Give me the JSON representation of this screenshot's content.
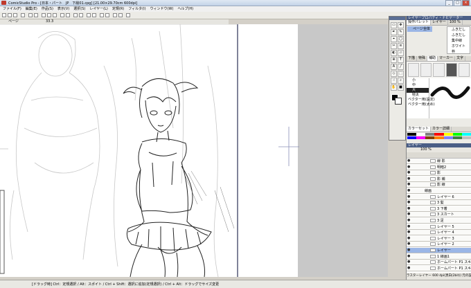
{
  "window": {
    "title": "ComicStudio Pro - [日本・パート　JP　下絵01.cpg] [21.00×29.70cm 600dpi]",
    "minimize": "_",
    "maximize": "□",
    "close": "×"
  },
  "menu": [
    "ファイル(F)",
    "編集(E)",
    "作品(S)",
    "表示(V)",
    "選択(S)",
    "レイヤー(L)",
    "定規(R)",
    "フィルタ(I)",
    "ウィンドウ(W)",
    "ヘルプ(H)"
  ],
  "docbar": {
    "page_label": "ページ",
    "zoom": "33.3"
  },
  "tool_palette": {
    "tools": [
      "▭",
      "✥",
      "✒",
      "✎",
      "⌖",
      "◯",
      "✂",
      "≋",
      "◐",
      "▱",
      "⊕",
      "T",
      "A",
      "╱",
      "◇",
      "⬚",
      "☝",
      "⌕",
      "✋",
      "■"
    ]
  },
  "pages_panel": {
    "title": "レイヤープロパティ・ナビゲーター",
    "tabs": [
      "操作パレット",
      "レイヤー",
      "100 %"
    ],
    "page_name": "ページ全体",
    "items": [
      "ふきだし",
      "ふきだし",
      "集中線",
      "ホワイト",
      "枠"
    ]
  },
  "tool_options": {
    "tabs": [
      "下描",
      "特殊",
      "補助",
      "マーカー",
      "文字"
    ],
    "brush_labels": [
      "小",
      "中",
      "大",
      "極太"
    ],
    "presets": [
      "ベクター用(設定)",
      "ベクター用(太め)"
    ]
  },
  "color_palette": {
    "tabs": [
      "カラーセット",
      "カラー詳細"
    ],
    "swatches": [
      "#000000",
      "#ffffff",
      "#7f7f7f",
      "#ff0000",
      "#ffff00",
      "#00ff00",
      "#00ffff",
      "#0000ff",
      "#ff00ff",
      "#804000",
      "#ff8000",
      "#8080ff",
      "#408040",
      "#c0c0c0"
    ]
  },
  "layer_panel": {
    "title": "レイヤー",
    "opacity": "100 %",
    "layers": [
      {
        "name": "線 影",
        "selected": false,
        "folder": false
      },
      {
        "name": "明暗2",
        "selected": false,
        "folder": false
      },
      {
        "name": "影",
        "selected": false,
        "folder": false
      },
      {
        "name": "影 補",
        "selected": false,
        "folder": false
      },
      {
        "name": "影 線",
        "selected": false,
        "folder": false
      },
      {
        "name": "線画",
        "selected": false,
        "folder": true
      },
      {
        "name": "レイヤー 6",
        "selected": false,
        "folder": false
      },
      {
        "name": "3 髪",
        "selected": false,
        "folder": false
      },
      {
        "name": "3 下着",
        "selected": false,
        "folder": false
      },
      {
        "name": "3 スカート",
        "selected": false,
        "folder": false
      },
      {
        "name": "3 足",
        "selected": false,
        "folder": false
      },
      {
        "name": "レイヤー 5",
        "selected": false,
        "folder": false
      },
      {
        "name": "レイヤー 4",
        "selected": false,
        "folder": false
      },
      {
        "name": "レイヤー 3",
        "selected": false,
        "folder": false
      },
      {
        "name": "レイヤー 2",
        "selected": false,
        "folder": false
      },
      {
        "name": "レイヤー",
        "selected": true,
        "folder": false
      },
      {
        "name": "1 線画1",
        "selected": false,
        "folder": false
      },
      {
        "name": "ホームパート P1 スキャンの日",
        "selected": false,
        "folder": false
      },
      {
        "name": "ホームパート P1 スキャン",
        "selected": false,
        "folder": false
      }
    ],
    "footer": "ラスターレイヤー 600 dpi(黒白(2bit)) 元の設定"
  },
  "status": {
    "message": "[ドラッグ時] Ctrl：定規選択 / Alt：スポイト / Ctrl + Shift：選択に追加(定規選択) / Ctrl + Alt：ドラッグでサイズ変更"
  },
  "colors": {
    "accent": "#4a5e86",
    "selected": "#9bb6e6",
    "canvas": "#ffffff",
    "pasteboard": "#c8c8c8"
  }
}
